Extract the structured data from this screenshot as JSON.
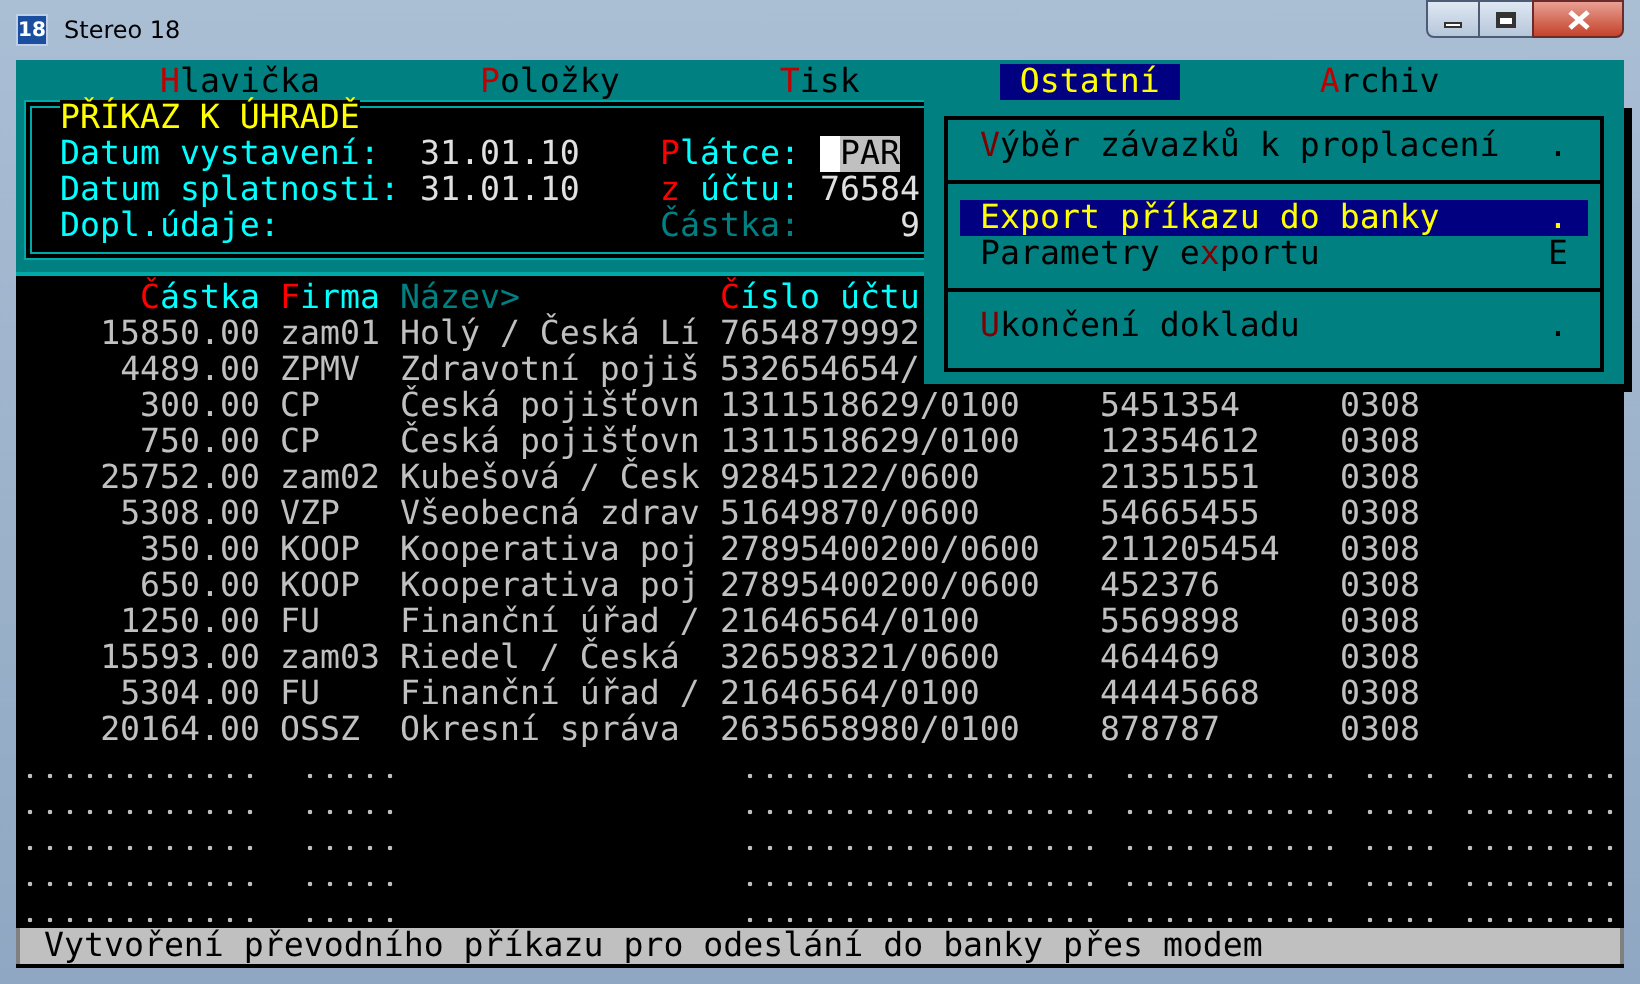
{
  "window": {
    "title": "Stereo 18",
    "icon_text": "18"
  },
  "menu": [
    {
      "hotkey": "H",
      "after": "lavička",
      "selected": false
    },
    {
      "hotkey": "P",
      "after": "oložky",
      "selected": false
    },
    {
      "hotkey": "T",
      "after": "isk",
      "selected": false
    },
    {
      "hotkey": "O",
      "after": "statní",
      "selected": true
    },
    {
      "hotkey": "A",
      "after": "rchiv",
      "selected": false
    }
  ],
  "dropdown": [
    {
      "kind": "item",
      "hotkey": "V",
      "after": "ýběr závazků k proplacení",
      "mark": ".",
      "selected": false
    },
    {
      "kind": "separator"
    },
    {
      "kind": "item",
      "hotkey": "E",
      "after": "xport příkazu do banky",
      "mark": ".",
      "selected": true
    },
    {
      "kind": "item",
      "before": "Parametry e",
      "hotkey": "x",
      "after": "portu",
      "mark": "E",
      "selected": false
    },
    {
      "kind": "separator"
    },
    {
      "kind": "item",
      "hotkey": "U",
      "after": "končení dokladu",
      "mark": ".",
      "selected": false
    }
  ],
  "header_panel": {
    "title": "PŘÍKAZ K ÚHRADĚ",
    "lines": [
      {
        "label": "Datum vystavení:",
        "value": "31.01.10",
        "right": {
          "hotkey": "P",
          "after": "látce:",
          "value": "PAR",
          "focused": true,
          "dim": false
        }
      },
      {
        "label": "Datum splatnosti:",
        "value": "31.01.10",
        "right": {
          "hotkey": "z",
          "after": " účtu:",
          "value": "76584",
          "focused": false,
          "dim": false
        }
      },
      {
        "label": "Dopl.údaje:",
        "right": {
          "after": "Částka:",
          "value": "9",
          "focused": false,
          "dim": true
        }
      }
    ]
  },
  "table": {
    "columns": [
      {
        "hotkey": "Č",
        "after": "ástka",
        "dim": false
      },
      {
        "hotkey": "F",
        "after": "irma",
        "dim": false
      },
      {
        "after": "Název>",
        "dim": true
      },
      {
        "hotkey": "Č",
        "after": "íslo účtu",
        "dim": false
      }
    ],
    "rows": [
      {
        "amount": "15850.00",
        "firm": "zam01",
        "name": "Holý / Česká Lí",
        "account": "7654879992"
      },
      {
        "amount": "4489.00",
        "firm": "ZPMV",
        "name": "Zdravotní pojiš",
        "account": "532654654/"
      },
      {
        "amount": "300.00",
        "firm": "CP",
        "name": "Česká pojišťovn",
        "account": "1311518629/0100",
        "column_5": "5451354",
        "column_6": "0308"
      },
      {
        "amount": "750.00",
        "firm": "CP",
        "name": "Česká pojišťovn",
        "account": "1311518629/0100",
        "column_5": "12354612",
        "column_6": "0308"
      },
      {
        "amount": "25752.00",
        "firm": "zam02",
        "name": "Kubešová / Česk",
        "account": "92845122/0600",
        "column_5": "21351551",
        "column_6": "0308"
      },
      {
        "amount": "5308.00",
        "firm": "VZP",
        "name": "Všeobecná zdrav",
        "account": "51649870/0600",
        "column_5": "54665455",
        "column_6": "0308"
      },
      {
        "amount": "350.00",
        "firm": "KOOP",
        "name": "Kooperativa poj",
        "account": "27895400200/0600",
        "column_5": "211205454",
        "column_6": "0308"
      },
      {
        "amount": "650.00",
        "firm": "KOOP",
        "name": "Kooperativa poj",
        "account": "27895400200/0600",
        "column_5": "452376",
        "column_6": "0308"
      },
      {
        "amount": "1250.00",
        "firm": "FU",
        "name": "Finanční úřad /",
        "account": "21646564/0100",
        "column_5": "5569898",
        "column_6": "0308"
      },
      {
        "amount": "15593.00",
        "firm": "zam03",
        "name": "Riedel / Česká",
        "account": "326598321/0600",
        "column_5": "464469",
        "column_6": "0308"
      },
      {
        "amount": "5304.00",
        "firm": "FU",
        "name": "Finanční úřad /",
        "account": "21646564/0100",
        "column_5": "44445668",
        "column_6": "0308"
      },
      {
        "amount": "20164.00",
        "firm": "OSSZ",
        "name": "Okresní správa",
        "account": "2635658980/0100",
        "column_5": "878787",
        "column_6": "0308"
      }
    ]
  },
  "status_bar": "Vytvoření převodního příkazu pro odeslání do banky přes modem"
}
